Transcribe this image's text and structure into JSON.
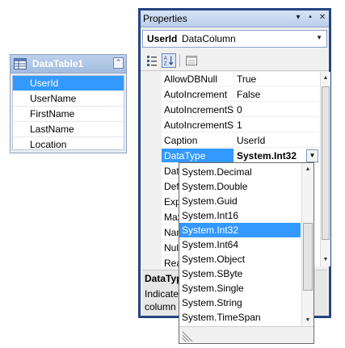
{
  "datatable": {
    "title": "DataTable1",
    "columns": [
      "UserId",
      "UserName",
      "FirstName",
      "LastName",
      "Location"
    ],
    "selected": "UserId",
    "icon": "table-icon",
    "collapse_icon": "double-chevron-up-icon"
  },
  "properties": {
    "window_title": "Properties",
    "object_name": "UserId",
    "object_type": "DataColumn",
    "toolbar": [
      "categorized-icon",
      "alphabetical-icon",
      "property-pages-icon"
    ],
    "rows": [
      {
        "name": "AllowDBNull",
        "value": "True"
      },
      {
        "name": "AutoIncrement",
        "value": "False"
      },
      {
        "name": "AutoIncrementSeed",
        "value": "0"
      },
      {
        "name": "AutoIncrementStep",
        "value": "1"
      },
      {
        "name": "Caption",
        "value": "UserId"
      },
      {
        "name": "DataType",
        "value": "System.Int32"
      },
      {
        "name": "DateTimeMode",
        "value": ""
      },
      {
        "name": "DefaultValue",
        "value": ""
      },
      {
        "name": "Expression",
        "value": ""
      },
      {
        "name": "MaxLength",
        "value": ""
      },
      {
        "name": "Name",
        "value": ""
      },
      {
        "name": "NullValue",
        "value": ""
      },
      {
        "name": "ReadOnly",
        "value": ""
      }
    ],
    "selected_property": "DataType",
    "description_title": "DataType",
    "description_line1": "Indicates",
    "description_line2": "column"
  },
  "dropdown": {
    "items": [
      "System.Decimal",
      "System.Double",
      "System.Guid",
      "System.Int16",
      "System.Int32",
      "System.Int64",
      "System.Object",
      "System.SByte",
      "System.Single",
      "System.String",
      "System.TimeSpan"
    ],
    "selected": "System.Int32"
  },
  "colors": {
    "selection": "#3399ff",
    "window_border": "#25457f"
  }
}
